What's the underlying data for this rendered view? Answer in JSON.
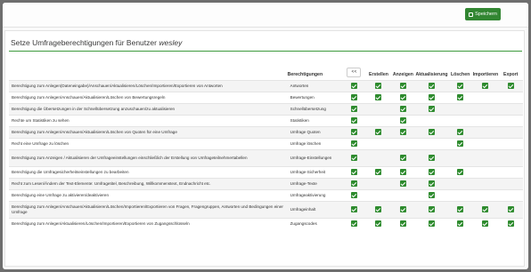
{
  "toolbar": {
    "save_label": "Speichern"
  },
  "panel": {
    "title_prefix": "Setze Umfrageberechtigungen für Benutzer",
    "username": "wesley"
  },
  "table": {
    "col_area": "Berechtigungen",
    "toggle_all": "<<",
    "cols": [
      "Erstellen",
      "Anzeigen",
      "Aktualisierung",
      "Löschen",
      "Importieren",
      "Export"
    ],
    "rows": [
      {
        "desc": "Berechtigung zum Anlegen(Dateneingabe)/Anschauen/Aktualisieren/Löschen/Importieren/Exportieren von Antworten",
        "area": "Antworten",
        "all": true,
        "perms": [
          true,
          true,
          true,
          true,
          true,
          true
        ]
      },
      {
        "desc": "Berechtigung zum Anlegen/Anschauen/Aktualisieren/Löschen von Bewertungsregeln",
        "area": "Bewertungen",
        "all": true,
        "perms": [
          true,
          true,
          true,
          true,
          false,
          false
        ]
      },
      {
        "desc": "Berechtigung die Übersetzungen in der Schnellübersetzung anzuschauen/zu aktualisieren",
        "area": "Schnellübersetzung",
        "all": true,
        "perms": [
          false,
          true,
          true,
          false,
          false,
          false
        ]
      },
      {
        "desc": "Rechte um Statistiken zu sehen",
        "area": "Statistiken",
        "all": true,
        "perms": [
          false,
          true,
          false,
          false,
          false,
          false
        ]
      },
      {
        "desc": "Berechtigung zum Anlegen/Anschauen/Aktualisieren/Löschen von Quoten für eine Umfrage",
        "area": "Umfrage Quoten",
        "all": true,
        "perms": [
          true,
          true,
          true,
          true,
          false,
          false
        ]
      },
      {
        "desc": "Recht eine Umfrage zu löschen",
        "area": "Umfrage löschen",
        "all": true,
        "perms": [
          false,
          false,
          false,
          true,
          false,
          false
        ]
      },
      {
        "desc": "Berechtigung zum Anzeigen / Aktualisieren der Umfrageeinstellungen einschließlich der Erstellung von Umfrageteilnehmertabellen",
        "area": "Umfrage-Einstellungen",
        "all": true,
        "perms": [
          false,
          true,
          true,
          false,
          false,
          false
        ]
      },
      {
        "desc": "Berechtigung die Umfragesicherheitseinstellungen zu bearbeiten",
        "area": "Umfrage-Sicherheit",
        "all": true,
        "perms": [
          true,
          true,
          true,
          true,
          false,
          false
        ]
      },
      {
        "desc": "Recht zum Lesen/Ändern der Text-Elemente: Umfragetitel, Beschreibung, Willkommenstext, Endnachricht etc.",
        "area": "Umfrage-Texte",
        "all": true,
        "perms": [
          false,
          true,
          true,
          false,
          false,
          false
        ]
      },
      {
        "desc": "Berechtigung eine Umfrage zu aktivieren/deaktivieren",
        "area": "Umfrageaktivierung",
        "all": true,
        "perms": [
          false,
          false,
          true,
          false,
          false,
          false
        ]
      },
      {
        "desc": "Berechtigung zum Anlegen/Anschauen/Aktualisieren/Löschen/Importieren/Exportieren von Fragen, Fragengruppen, Antworten und Bedingungen einer Umfrage",
        "area": "Umfrageinhalt",
        "all": true,
        "perms": [
          true,
          true,
          true,
          true,
          true,
          true
        ]
      },
      {
        "desc": "Berechtigung zum Anlegen/Aktualisieren/Löschen/Importieren/Exportieren von Zugangsschlüsseln",
        "area": "Zugangscodes",
        "all": true,
        "perms": [
          true,
          true,
          true,
          true,
          true,
          true
        ]
      }
    ]
  }
}
